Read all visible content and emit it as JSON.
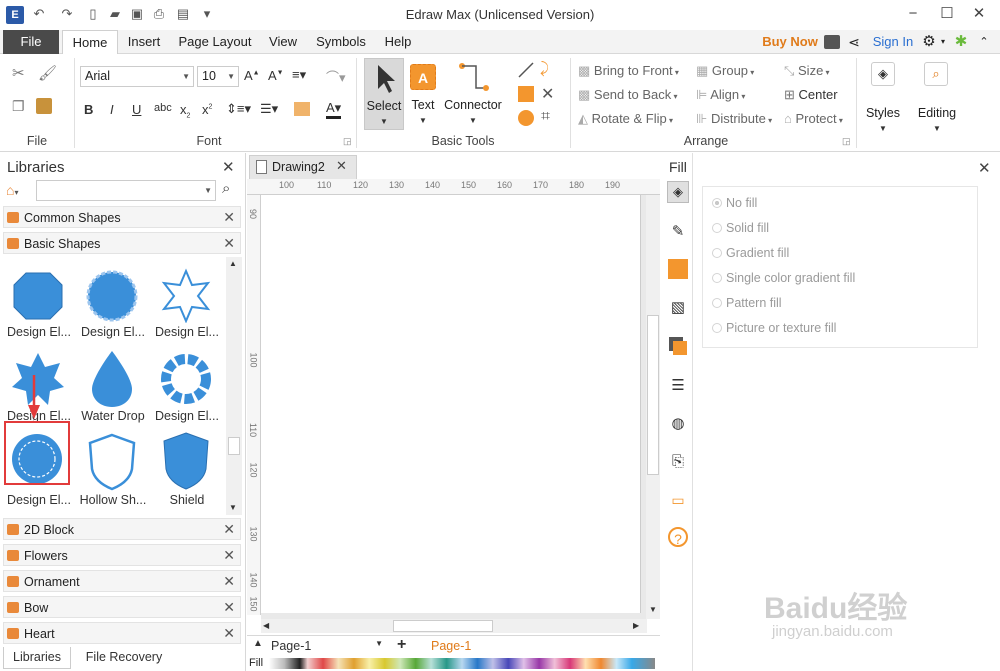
{
  "app": {
    "title": "Edraw Max (Unlicensed Version)"
  },
  "menu": {
    "tabs": [
      "File",
      "Home",
      "Insert",
      "Page Layout",
      "View",
      "Symbols",
      "Help"
    ],
    "buy_now": "Buy Now",
    "sign_in": "Sign In"
  },
  "ribbon": {
    "file_group": "File",
    "font": {
      "family": "Arial",
      "size": "10",
      "group": "Font"
    },
    "basic_tools": {
      "select": "Select",
      "text": "Text",
      "connector": "Connector",
      "group": "Basic Tools"
    },
    "arrange": {
      "bring_to_front": "Bring to Front",
      "send_to_back": "Send to Back",
      "rotate_flip": "Rotate & Flip",
      "group": "Group",
      "align": "Align",
      "distribute": "Distribute",
      "size": "Size",
      "center": "Center",
      "protect": "Protect",
      "group_label": "Arrange"
    },
    "styles": "Styles",
    "editing": "Editing"
  },
  "libraries": {
    "title": "Libraries",
    "search_placeholder": "",
    "categories_top": [
      "Common Shapes",
      "Basic Shapes"
    ],
    "shapes": [
      {
        "label": "Design El...",
        "icon": "octagon-badge-icon"
      },
      {
        "label": "Design El...",
        "icon": "scalloped-circle-icon"
      },
      {
        "label": "Design El...",
        "icon": "star-outline-icon"
      },
      {
        "label": "Design El...",
        "icon": "eight-point-star-icon"
      },
      {
        "label": "Water Drop",
        "icon": "water-drop-icon"
      },
      {
        "label": "Design El...",
        "icon": "beaded-ring-icon"
      },
      {
        "label": "Design El...",
        "icon": "dashed-scallop-icon"
      },
      {
        "label": "Hollow Sh...",
        "icon": "hollow-shield-icon"
      },
      {
        "label": "Shield",
        "icon": "shield-icon"
      }
    ],
    "categories_bottom": [
      "2D Block",
      "Flowers",
      "Ornament",
      "Bow",
      "Heart"
    ],
    "bottom_tabs": [
      "Libraries",
      "File Recovery"
    ]
  },
  "document": {
    "tab": "Drawing2",
    "ruler_top": [
      "100",
      "110",
      "120",
      "130",
      "140",
      "150",
      "160",
      "170",
      "180",
      "190"
    ],
    "ruler_left": [
      "90",
      "100",
      "110",
      "120",
      "130",
      "140",
      "150"
    ],
    "page_select": "Page-1",
    "page_tab": "Page-1",
    "fill_label": "Fill"
  },
  "fill_panel": {
    "title": "Fill",
    "options": [
      "No fill",
      "Solid fill",
      "Gradient fill",
      "Single color gradient fill",
      "Pattern fill",
      "Picture or texture fill"
    ],
    "selected": "No fill"
  },
  "watermark": {
    "line1": "Baidu经验",
    "line2": "jingyan.baidu.com"
  },
  "colors": {
    "accent": "#3a8fd9",
    "buy": "#e07b1a",
    "highlight": "#e23b3b",
    "orange": "#f3962e"
  }
}
